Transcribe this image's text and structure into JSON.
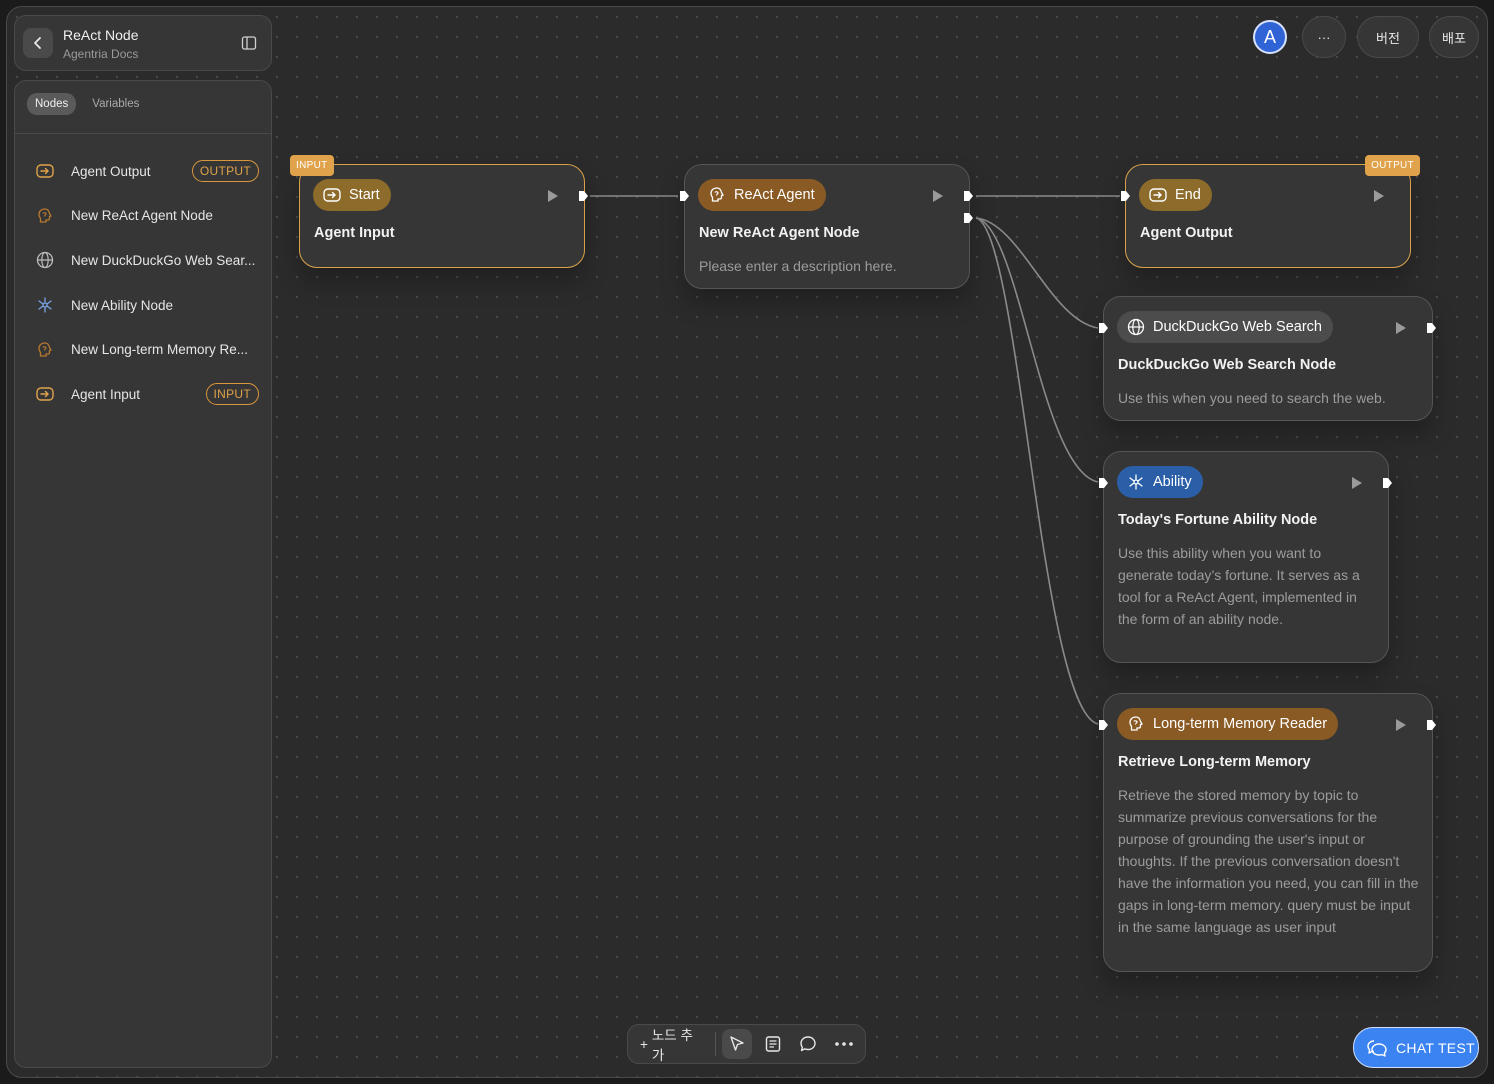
{
  "app": {
    "title": "ReAct Node",
    "subtitle": "Agentria Docs"
  },
  "sidebar": {
    "tabs": [
      {
        "label": "Nodes",
        "active": true
      },
      {
        "label": "Variables",
        "active": false
      }
    ],
    "items": [
      {
        "label": "Agent Output",
        "icon": "io-icon",
        "badge": "OUTPUT"
      },
      {
        "label": "New ReAct Agent Node",
        "icon": "brain-icon",
        "badge": ""
      },
      {
        "label": "New DuckDuckGo Web Sear...",
        "icon": "globe-icon",
        "badge": ""
      },
      {
        "label": "New Ability Node",
        "icon": "ability-icon",
        "badge": ""
      },
      {
        "label": "New Long-term Memory Re...",
        "icon": "brain-icon",
        "badge": ""
      },
      {
        "label": "Agent Input",
        "icon": "io-icon",
        "badge": "INPUT"
      }
    ]
  },
  "header_right": {
    "avatar": "A",
    "more": "···",
    "version": "버전",
    "deploy": "배포"
  },
  "nodes": {
    "start": {
      "tag": "INPUT",
      "pill": "Start",
      "title": "Agent Input"
    },
    "react": {
      "pill": "ReAct Agent",
      "title": "New ReAct Agent Node",
      "desc": "Please enter a description here."
    },
    "end": {
      "tag": "OUTPUT",
      "pill": "End",
      "title": "Agent Output"
    },
    "ddg": {
      "pill": "DuckDuckGo Web Search",
      "title": "DuckDuckGo Web Search Node",
      "desc": "Use this when you need to search the web."
    },
    "ability": {
      "pill": "Ability",
      "title": "Today's Fortune Ability Node",
      "desc": "Use this ability when you want to generate today’s fortune. It serves as a tool for a ReAct Agent, implemented in the form of an ability node."
    },
    "memory": {
      "pill": "Long-term Memory Reader",
      "title": "Retrieve Long-term Memory",
      "desc": "Retrieve the stored memory by topic to summarize previous conversations for the purpose of grounding the user's input or thoughts. If the previous conversation doesn't have the information you need, you can fill in the gaps in long-term memory. query must be input in the same language as user input"
    }
  },
  "toolbar": {
    "add_node": "노드 추가",
    "add_prefix": "+"
  },
  "chat_test": {
    "label": "CHAT TEST"
  },
  "colors": {
    "accent_gold": "#d9a24a",
    "brand_blue": "#3b83f0",
    "ability_blue": "#2a5fa8"
  }
}
